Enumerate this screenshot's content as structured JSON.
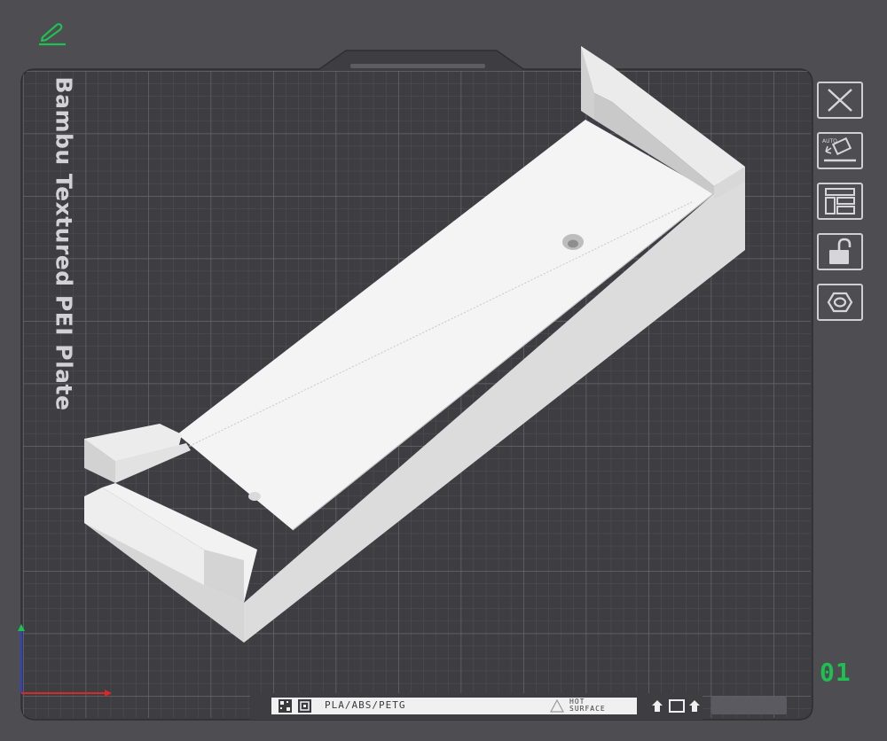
{
  "bed": {
    "plate_name": "Bambu Textured PEI Plate",
    "plate_number": "01",
    "strip": {
      "material": "PLA/ABS/PETG",
      "hot_surface_line1": "HOT",
      "hot_surface_line2": "SURFACE"
    }
  },
  "toolbar": {
    "buttons": [
      {
        "name": "close",
        "icon": "close-icon"
      },
      {
        "name": "auto-orient",
        "icon": "auto-orient-icon",
        "badge": "AUTO"
      },
      {
        "name": "arrange",
        "icon": "arrange-icon"
      },
      {
        "name": "lock",
        "icon": "lock-open-icon"
      },
      {
        "name": "plate-settings",
        "icon": "hex-nut-icon"
      }
    ]
  },
  "colors": {
    "background": "#4d4d52",
    "plate": "#3e3e42",
    "grid_line": "#5a5a60",
    "model": "#f4f4f4",
    "accent_green": "#1fbf52",
    "axis_x": "#d42a2a",
    "axis_y": "#2a3fd4",
    "axis_z": "#1fbf52"
  }
}
